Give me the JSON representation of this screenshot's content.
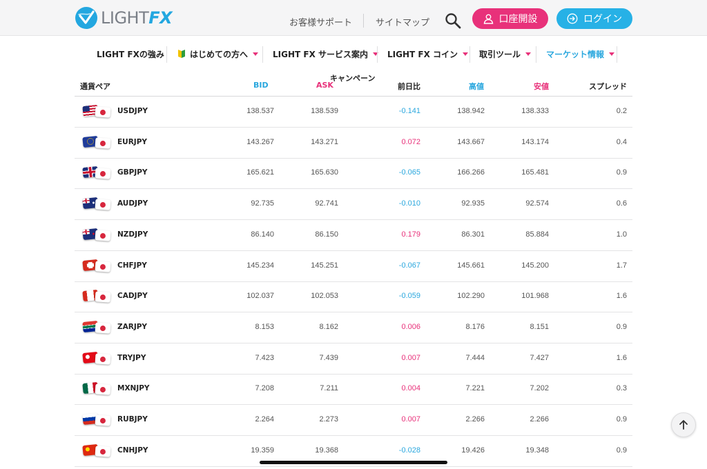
{
  "header": {
    "logo_text_main": "LIGHT",
    "logo_text_accent": "FX",
    "support_label": "お客様サポート",
    "sitemap_label": "サイトマップ",
    "open_account_label": "口座開設",
    "login_label": "ログイン"
  },
  "nav": {
    "items": [
      {
        "label": "LIGHT FXの強み"
      },
      {
        "label": "はじめての方へ"
      },
      {
        "label": "LIGHT FX サービス案内"
      },
      {
        "label": "LIGHT FX コイン"
      },
      {
        "label": "取引ツール"
      },
      {
        "label": "マーケット情報"
      }
    ]
  },
  "table": {
    "headers": {
      "pair": "通貨ペア",
      "bid": "BID",
      "ask": "ASK",
      "campaign": "キャンペーン",
      "change": "前日比",
      "high": "高値",
      "low": "安値",
      "spread": "スプレッド"
    },
    "rows": [
      {
        "pair": "USDJPY",
        "bid": "138.537",
        "ask": "138.539",
        "change": "-0.141",
        "high": "138.942",
        "low": "138.333",
        "spread": "0.2",
        "flag": "us"
      },
      {
        "pair": "EURJPY",
        "bid": "143.267",
        "ask": "143.271",
        "change": "0.072",
        "high": "143.667",
        "low": "143.174",
        "spread": "0.4",
        "flag": "eu"
      },
      {
        "pair": "GBPJPY",
        "bid": "165.621",
        "ask": "165.630",
        "change": "-0.065",
        "high": "166.266",
        "low": "165.481",
        "spread": "0.9",
        "flag": "gb"
      },
      {
        "pair": "AUDJPY",
        "bid": "92.735",
        "ask": "92.741",
        "change": "-0.010",
        "high": "92.935",
        "low": "92.574",
        "spread": "0.6",
        "flag": "au"
      },
      {
        "pair": "NZDJPY",
        "bid": "86.140",
        "ask": "86.150",
        "change": "0.179",
        "high": "86.301",
        "low": "85.884",
        "spread": "1.0",
        "flag": "nz"
      },
      {
        "pair": "CHFJPY",
        "bid": "145.234",
        "ask": "145.251",
        "change": "-0.067",
        "high": "145.661",
        "low": "145.200",
        "spread": "1.7",
        "flag": "ch"
      },
      {
        "pair": "CADJPY",
        "bid": "102.037",
        "ask": "102.053",
        "change": "-0.059",
        "high": "102.290",
        "low": "101.968",
        "spread": "1.6",
        "flag": "ca"
      },
      {
        "pair": "ZARJPY",
        "bid": "8.153",
        "ask": "8.162",
        "change": "0.006",
        "high": "8.176",
        "low": "8.151",
        "spread": "0.9",
        "flag": "za"
      },
      {
        "pair": "TRYJPY",
        "bid": "7.423",
        "ask": "7.439",
        "change": "0.007",
        "high": "7.444",
        "low": "7.427",
        "spread": "1.6",
        "flag": "tr"
      },
      {
        "pair": "MXNJPY",
        "bid": "7.208",
        "ask": "7.211",
        "change": "0.004",
        "high": "7.221",
        "low": "7.202",
        "spread": "0.3",
        "flag": "mx"
      },
      {
        "pair": "RUBJPY",
        "bid": "2.264",
        "ask": "2.273",
        "change": "0.007",
        "high": "2.266",
        "low": "2.266",
        "spread": "0.9",
        "flag": "ru"
      },
      {
        "pair": "CNHJPY",
        "bid": "19.359",
        "ask": "19.368",
        "change": "-0.028",
        "high": "19.426",
        "low": "19.348",
        "spread": "0.9",
        "flag": "cn"
      }
    ]
  },
  "colors": {
    "accent_blue": "#2aa7de",
    "accent_pink": "#e8317a",
    "header_bg": "#f5f5f6"
  },
  "icons": {
    "search": "search-icon",
    "open_account": "user-icon",
    "login": "login-arrow-icon",
    "scroll_top": "arrow-up-icon",
    "beginner": "beginner-mark-icon"
  }
}
